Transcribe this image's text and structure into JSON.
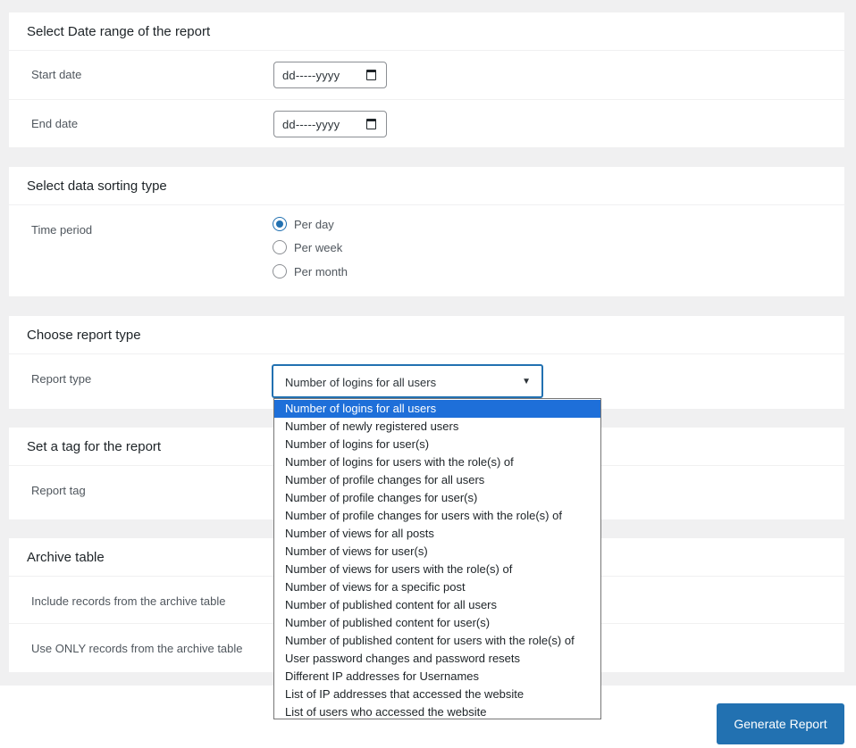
{
  "date_range": {
    "title": "Select Date range of the report",
    "start_label": "Start date",
    "start_value": "dd-----yyyy",
    "end_label": "End date",
    "end_value": "dd-----yyyy"
  },
  "sorting": {
    "title": "Select data sorting type",
    "time_label": "Time period",
    "options": [
      "Per day",
      "Per week",
      "Per month"
    ],
    "selected": "Per day"
  },
  "report_type": {
    "title": "Choose report type",
    "label": "Report type",
    "selected": "Number of logins for all users",
    "options": [
      "Number of logins for all users",
      "Number of newly registered users",
      "Number of logins for user(s)",
      "Number of logins for users with the role(s) of",
      "Number of profile changes for all users",
      "Number of profile changes for user(s)",
      "Number of profile changes for users with the role(s) of",
      "Number of views for all posts",
      "Number of views for user(s)",
      "Number of views for users with the role(s) of",
      "Number of views for a specific post",
      "Number of published content for all users",
      "Number of published content for user(s)",
      "Number of published content for users with the role(s) of",
      "User password changes and password resets",
      "Different IP addresses for Usernames",
      "List of IP addresses that accessed the website",
      "List of users who accessed the website"
    ]
  },
  "tag": {
    "title": "Set a tag for the report",
    "label": "Report tag"
  },
  "archive": {
    "title": "Archive table",
    "include_label": "Include records from the archive table",
    "only_label": "Use ONLY records from the archive table"
  },
  "footer": {
    "generate_label": "Generate Report"
  },
  "colors": {
    "accent": "#2271b1",
    "selected_option": "#1e6fd9",
    "toggle": "#d63638"
  },
  "icons": {
    "calendar": "calendar-icon",
    "dropdown": "chevron-down-icon"
  }
}
